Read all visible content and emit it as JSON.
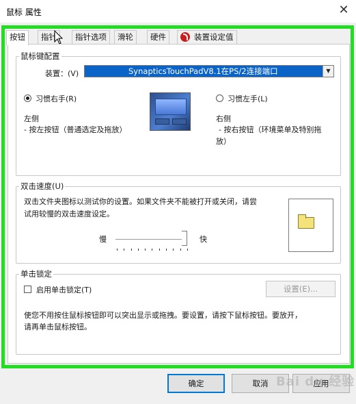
{
  "window": {
    "title": "鼠标 属性",
    "close_glyph": "✕"
  },
  "tabs": [
    {
      "label": "按钮",
      "active": true
    },
    {
      "label": "指针"
    },
    {
      "label": "指针选项"
    },
    {
      "label": "滑轮"
    },
    {
      "label": "硬件"
    },
    {
      "label": "装置设定值",
      "icon": "synaptics-icon"
    }
  ],
  "button_config": {
    "legend": "鼠标键配置",
    "device_label": "装置：(V)",
    "device_value": "SynapticsTouchPadV8.1在PS/2连接端口",
    "right_hand": {
      "label": "习惯右手(R)",
      "checked": true
    },
    "left_hand": {
      "label": "习惯左手(L)",
      "checked": false
    },
    "left_side_title": "左侧",
    "left_side_desc": "- 按左按钮（普通选定及拖放）",
    "right_side_title": "右侧",
    "right_side_desc_1": "- 按右按钮（环境菜单及特别拖",
    "right_side_desc_2": "放）",
    "image_icon": "touchpad-icon"
  },
  "double_click": {
    "legend": "双击速度(U)",
    "desc_1": "双击文件夹图标以测试你的设置。如果文件夹不能被打开或关闭，请尝",
    "desc_2": "试用较慢的双击速度设定。",
    "slow": "慢",
    "fast": "快",
    "slider_fraction": 0.95,
    "test_icon": "folder-icon"
  },
  "click_lock": {
    "legend": "单击锁定",
    "checkbox_label": "启用单击锁定(T)",
    "checked": false,
    "settings_button": "设置(E)...",
    "desc_1": "使您不用按住鼠标按钮即可以突出显示或拖拽。要设置，请按下鼠标按钮。要放开，",
    "desc_2": "请再单击鼠标按钮。"
  },
  "footer": {
    "ok": "确定",
    "cancel": "取消",
    "apply": "应用"
  },
  "watermark": "Bai du 经验"
}
